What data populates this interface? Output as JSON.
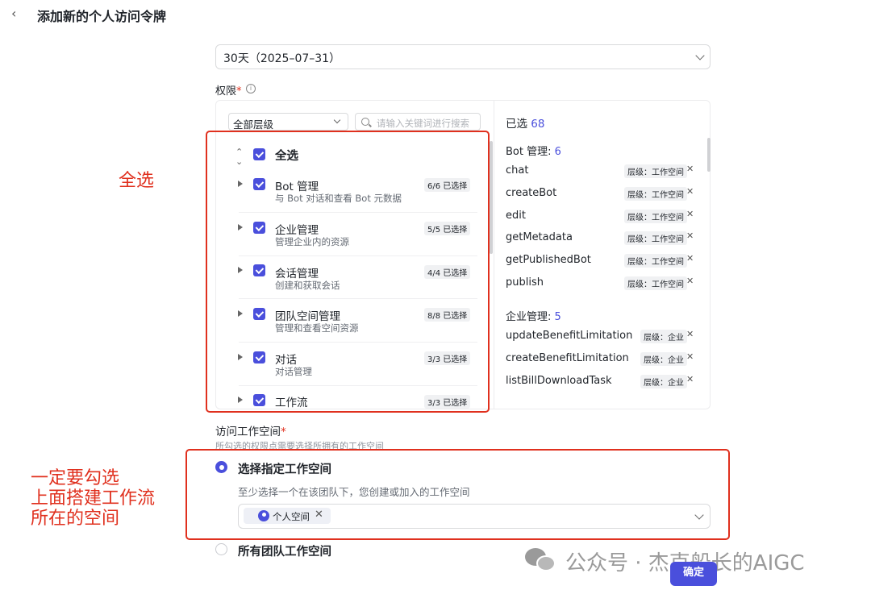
{
  "header": {
    "title": "添加新的个人访问令牌"
  },
  "expiry": {
    "value": "30天（2025–07–31）"
  },
  "permissions": {
    "label": "权限",
    "required_mark": "*",
    "info_icon": "info-icon",
    "level_filter": "全部层级",
    "search_placeholder": "请输入关键词进行搜索",
    "select_all_label": "全选",
    "items": [
      {
        "title": "Bot 管理",
        "desc": "与 Bot 对话和查看 Bot 元数据",
        "badge": "6/6 已选择"
      },
      {
        "title": "企业管理",
        "desc": "管理企业内的资源",
        "badge": "5/5 已选择"
      },
      {
        "title": "会话管理",
        "desc": "创建和获取会话",
        "badge": "4/4 已选择"
      },
      {
        "title": "团队空间管理",
        "desc": "管理和查看空间资源",
        "badge": "8/8 已选择"
      },
      {
        "title": "对话",
        "desc": "对话管理",
        "badge": "3/3 已选择"
      },
      {
        "title": "工作流",
        "desc": "",
        "badge": "3/3 已选择"
      }
    ]
  },
  "selected": {
    "label": "已选",
    "count": "68",
    "groups": [
      {
        "name": "Bot 管理:",
        "count": "6",
        "items": [
          {
            "api": "chat",
            "tag": "层级：工作空间"
          },
          {
            "api": "createBot",
            "tag": "层级：工作空间"
          },
          {
            "api": "edit",
            "tag": "层级：工作空间"
          },
          {
            "api": "getMetadata",
            "tag": "层级：工作空间"
          },
          {
            "api": "getPublishedBot",
            "tag": "层级：工作空间"
          },
          {
            "api": "publish",
            "tag": "层级：工作空间"
          }
        ]
      },
      {
        "name": "企业管理:",
        "count": "5",
        "items": [
          {
            "api": "updateBenefitLimitation",
            "tag": "层级：企业"
          },
          {
            "api": "createBenefitLimitation",
            "tag": "层级：企业"
          },
          {
            "api": "listBillDownloadTask",
            "tag": "层级：企业"
          }
        ]
      }
    ]
  },
  "workspace": {
    "label": "访问工作空间",
    "required_mark": "*",
    "hint": "所勾选的权限点需要选择所拥有的工作空间",
    "option_specific": "选择指定工作空间",
    "option_specific_desc": "至少选择一个在该团队下，您创建或加入的工作空间",
    "chip_label": "个人空间",
    "option_all": "所有团队工作空间"
  },
  "confirm_button": "确定",
  "annotations": {
    "select_all_note": "全选",
    "workspace_note_lines": [
      "一定要勾选",
      "上面搭建工作流",
      "所在的空间"
    ]
  },
  "watermark": "公众号 · 杰克船长的AIGC",
  "colors": {
    "accent": "#4a4fdc",
    "annotation_red": "#e0301e"
  }
}
